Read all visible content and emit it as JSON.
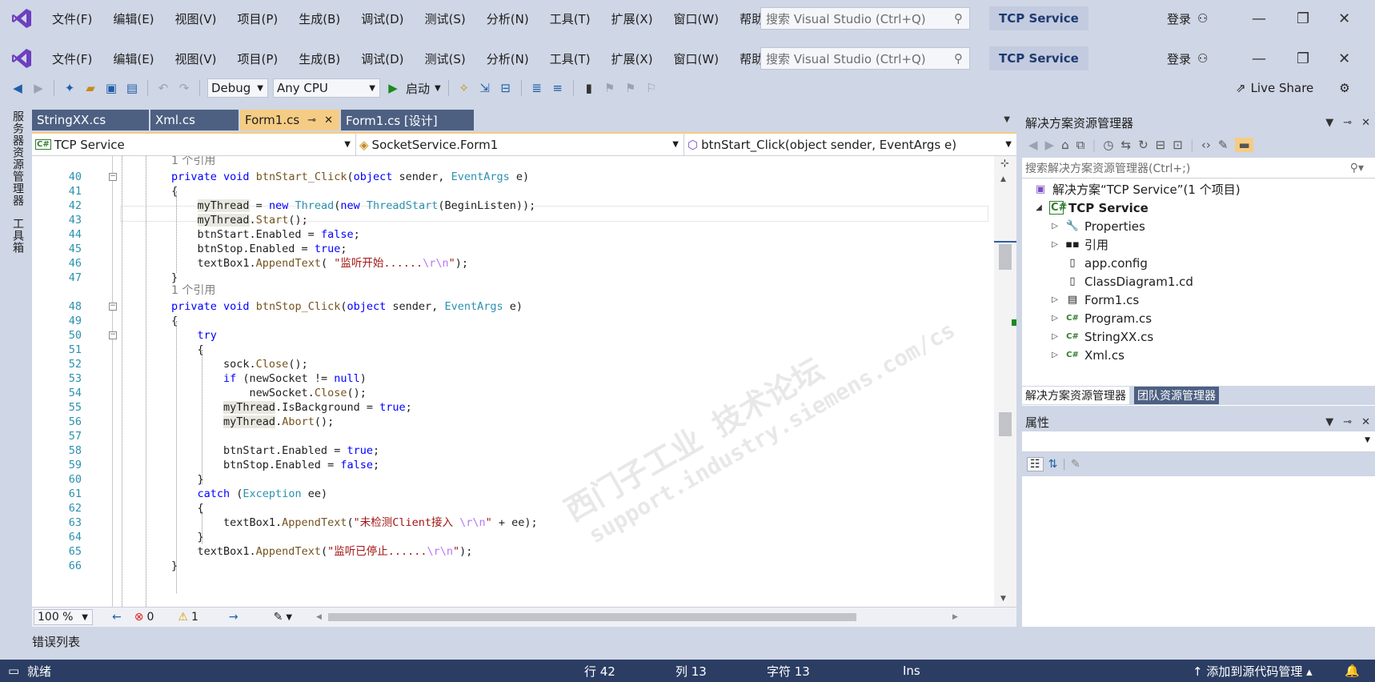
{
  "menu": [
    "文件(F)",
    "编辑(E)",
    "视图(V)",
    "项目(P)",
    "生成(B)",
    "调试(D)",
    "测试(S)",
    "分析(N)",
    "工具(T)",
    "扩展(X)",
    "窗口(W)",
    "帮助(H)"
  ],
  "search_placeholder": "搜索 Visual Studio (Ctrl+Q)",
  "solution_badge": "TCP Service",
  "login": "登录",
  "toolbar": {
    "config": "Debug",
    "platform": "Any CPU",
    "start": "启动",
    "liveshare": "Live Share"
  },
  "left_strip": [
    "服务器资源管理器",
    "工具箱"
  ],
  "tabs": [
    {
      "label": "StringXX.cs",
      "active": false
    },
    {
      "label": "Xml.cs",
      "active": false
    },
    {
      "label": "Form1.cs",
      "active": true
    },
    {
      "label": "Form1.cs [设计]",
      "active": false
    }
  ],
  "navbar": {
    "project": "TCP Service",
    "class": "SocketService.Form1",
    "member": "btnStart_Click(object sender, EventArgs e)"
  },
  "code": {
    "ref1": "1 个引用",
    "ref2": "1 个引用",
    "lines": {
      "l40": "40",
      "l41": "41",
      "l42": "42",
      "l43": "43",
      "l44": "44",
      "l45": "45",
      "l46": "46",
      "l47": "47",
      "l48": "48",
      "l49": "49",
      "l50": "50",
      "l51": "51",
      "l52": "52",
      "l53": "53",
      "l54": "54",
      "l55": "55",
      "l56": "56",
      "l57": "57",
      "l58": "58",
      "l59": "59",
      "l60": "60",
      "l61": "61",
      "l62": "62",
      "l63": "63",
      "l64": "64",
      "l65": "65",
      "l66": "66"
    },
    "s46": "\"监听开始......",
    "s63": "\"未检测Client接入 ",
    "s65": "\"监听已停止......"
  },
  "watermark": {
    "line1": "西门子工业 技术论坛",
    "line2": "support.industry.siemens.com/cs"
  },
  "editor_status": {
    "zoom": "100 %",
    "errors": "0",
    "warnings": "1"
  },
  "solution_explorer": {
    "title": "解决方案资源管理器",
    "search": "搜索解决方案资源管理器(Ctrl+;)",
    "items": [
      {
        "label": "解决方案“TCP Service”(1 个项目)"
      },
      {
        "label": "TCP Service"
      },
      {
        "label": "Properties"
      },
      {
        "label": "引用"
      },
      {
        "label": "app.config"
      },
      {
        "label": "ClassDiagram1.cd"
      },
      {
        "label": "Form1.cs"
      },
      {
        "label": "Program.cs"
      },
      {
        "label": "StringXX.cs"
      },
      {
        "label": "Xml.cs"
      }
    ],
    "tab_active": "解决方案资源管理器",
    "tab_other": "团队资源管理器"
  },
  "properties": {
    "title": "属性"
  },
  "bottom_tab": "错误列表",
  "status": {
    "ready": "就绪",
    "row": "行 42",
    "col": "列 13",
    "char": "字符 13",
    "ins": "Ins",
    "source": "添加到源代码管理"
  }
}
